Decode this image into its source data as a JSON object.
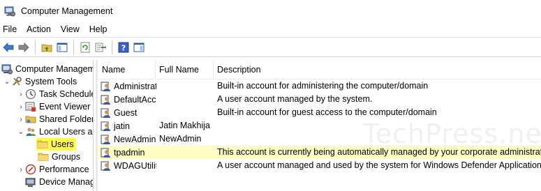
{
  "window": {
    "title": "Computer Management"
  },
  "menu": [
    "File",
    "Action",
    "View",
    "Help"
  ],
  "toolbar": {
    "buttons": [
      "back-icon",
      "forward-icon",
      "up-folder-icon",
      "show-hide-tree-icon",
      "refresh-icon",
      "export-list-icon",
      "help-icon",
      "show-hide-action-pane-icon"
    ]
  },
  "tree": {
    "root": "Computer Management (Local)",
    "system_tools": "System Tools",
    "task_scheduler": "Task Scheduler",
    "event_viewer": "Event Viewer",
    "shared_folders": "Shared Folders",
    "local_users": "Local Users and Groups",
    "users": "Users",
    "groups": "Groups",
    "performance": "Performance",
    "device_manager": "Device Manager"
  },
  "columns": {
    "name": "Name",
    "full_name": "Full Name",
    "description": "Description"
  },
  "users": [
    {
      "name": "Administrator",
      "full_name": "",
      "description": "Built-in account for administering the computer/domain"
    },
    {
      "name": "DefaultAccount",
      "full_name": "",
      "description": "A user account managed by the system."
    },
    {
      "name": "Guest",
      "full_name": "",
      "description": "Built-in account for guest access to the computer/domain"
    },
    {
      "name": "jatin",
      "full_name": "Jatin Makhija",
      "description": ""
    },
    {
      "name": "NewAdmin",
      "full_name": "NewAdmin",
      "description": ""
    },
    {
      "name": "tpadmin",
      "full_name": "",
      "description": "This account is currently being automatically managed by your corporate administrator."
    },
    {
      "name": "WDAGUtilityAccount",
      "full_name": "",
      "description": "A user account managed and used by the system for Windows Defender Application Guard scenarios."
    }
  ],
  "watermark": "TechPress.net",
  "colors": {
    "selected_tree": "#ffff44",
    "highlight_row": "#fdfdc4"
  }
}
